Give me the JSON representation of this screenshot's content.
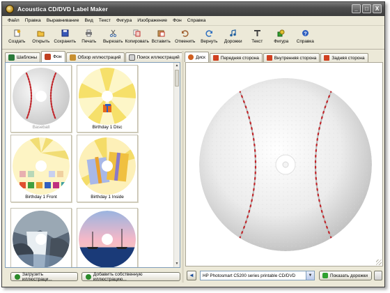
{
  "window": {
    "title": "Acoustica CD/DVD Label Maker",
    "controls": [
      "_",
      "□",
      "X"
    ]
  },
  "menu": [
    "Файл",
    "Правка",
    "Выравнивание",
    "Вид",
    "Текст",
    "Фигура",
    "Изображение",
    "Фон",
    "Справка"
  ],
  "toolbar": [
    {
      "label": "Создать",
      "icon": "new-icon",
      "color": "#d8a020"
    },
    {
      "label": "Открыть",
      "icon": "open-icon",
      "color": "#e0b030"
    },
    {
      "label": "Сохранить",
      "icon": "save-icon",
      "color": "#3050b0"
    },
    {
      "label": "Печать",
      "icon": "print-icon",
      "color": "#606060"
    },
    {
      "label": "Вырезать",
      "icon": "cut-icon",
      "color": "#3a6ab0"
    },
    {
      "label": "Копировать",
      "icon": "copy-icon",
      "color": "#c03030"
    },
    {
      "label": "Вставить",
      "icon": "paste-icon",
      "color": "#c03020"
    },
    {
      "label": "Отменить",
      "icon": "undo-icon",
      "color": "#a06030"
    },
    {
      "label": "Вернуть",
      "icon": "redo-icon",
      "color": "#3070c0"
    },
    {
      "label": "Дорожки",
      "icon": "tracks-icon",
      "color": "#2060a0"
    },
    {
      "label": "Текст",
      "icon": "text-icon",
      "color": "#404040"
    },
    {
      "label": "Фигура",
      "icon": "shape-icon",
      "color": "#30a030"
    },
    {
      "label": "Справка",
      "icon": "help-icon",
      "color": "#3060c0"
    }
  ],
  "left_tabs": [
    {
      "label": "Шаблоны",
      "icon": "templates-icon",
      "color": "#2a7a3a",
      "active": false
    },
    {
      "label": "Фон",
      "icon": "background-icon",
      "color": "#c04020",
      "active": true
    },
    {
      "label": "Обзор иллюстраций",
      "icon": "browse-icon",
      "color": "#c89030",
      "active": false
    },
    {
      "label": "Поиск иллюстраций",
      "icon": "search-icon",
      "color": "#606060",
      "active": false
    }
  ],
  "gallery": [
    {
      "caption": "Baseball",
      "dimmed": true,
      "art": "baseball"
    },
    {
      "caption": "Birthday 1 Disc",
      "dimmed": false,
      "art": "birthday-disc"
    },
    {
      "caption": "Birthday 1 Front",
      "dimmed": false,
      "art": "birthday-front"
    },
    {
      "caption": "Birthday 1 Inside",
      "dimmed": false,
      "art": "birthday-inside"
    },
    {
      "caption": "",
      "dimmed": false,
      "art": "waterfall"
    },
    {
      "caption": "",
      "dimmed": false,
      "art": "sunset-boats"
    }
  ],
  "left_buttons": [
    {
      "label": "Загрузить иллюстраци...",
      "icon": "load-icon",
      "color": "#2a8a2a"
    },
    {
      "label": "Добавить собственную иллюстрацию...",
      "icon": "add-icon",
      "color": "#2a8a2a"
    }
  ],
  "right_tabs": [
    {
      "label": "Диск",
      "color": "#d06020",
      "active": true
    },
    {
      "label": "Передняя сторона",
      "color": "#d04020",
      "active": false
    },
    {
      "label": "Внутренняя сторона",
      "color": "#d04020",
      "active": false
    },
    {
      "label": "Задняя сторона",
      "color": "#d04020",
      "active": false
    }
  ],
  "status": {
    "printer": "HP Photosmart C5200 series printable CD/DVD",
    "show_tracks": "Показать дорожки"
  }
}
